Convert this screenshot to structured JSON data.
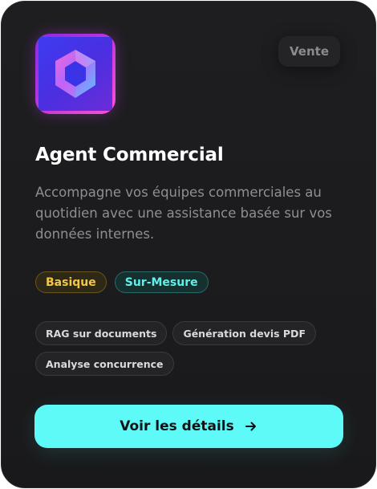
{
  "card": {
    "category": "Vente",
    "title": "Agent Commercial",
    "description": "Accompagne vos équipes commerciales au quotidien avec une assistance basée sur vos données internes.",
    "levels": [
      "Basique",
      "Sur-Mesure"
    ],
    "features": [
      "RAG sur documents",
      "Génération devis PDF",
      "Analyse concurrence"
    ],
    "cta_label": "Voir les détails",
    "logo_icon": "hexagon-ring-icon",
    "cta_icon": "arrow-right-icon"
  },
  "colors": {
    "card_bg": "#1c1c1e",
    "accent_cyan": "#5efaf7",
    "basique_yellow": "#f2c748",
    "mesure_cyan": "#5ff0ea",
    "logo_purple": "#8a2be2",
    "logo_pink": "#ff4fd8"
  }
}
